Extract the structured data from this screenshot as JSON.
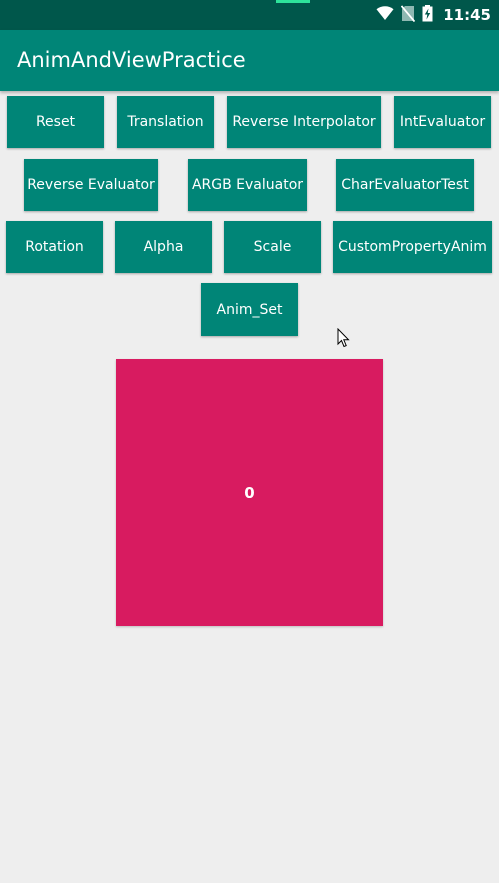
{
  "status_bar": {
    "time": "11:45",
    "icons": [
      "wifi-icon",
      "no-sim-icon",
      "battery-charging-icon"
    ]
  },
  "app_bar": {
    "title": "AnimAndViewPractice"
  },
  "buttons": {
    "reset": "Reset",
    "translation": "Translation",
    "reverse_interpolator": "Reverse Interpolator",
    "int_evaluator": "IntEvaluator",
    "reverse_evaluator": "Reverse Evaluator",
    "argb_evaluator": "ARGB Evaluator",
    "char_evaluator_test": "CharEvaluatorTest",
    "rotation": "Rotation",
    "alpha": "Alpha",
    "scale": "Scale",
    "custom_property_anim": "CustomPropertyAnim",
    "anim_set": "Anim_Set"
  },
  "anim_view": {
    "text": "0",
    "color": "#d81b60"
  },
  "colors": {
    "primary": "#008577",
    "primary_dark": "#00574b",
    "accent": "#d81b60",
    "background": "#eeeeee"
  }
}
